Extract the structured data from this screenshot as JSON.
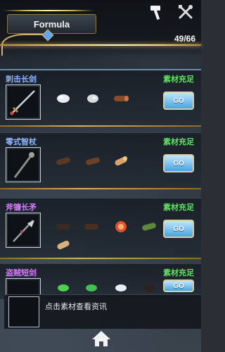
{
  "header": {
    "title": "Formula",
    "counter": "49/66",
    "icons": [
      "hammer-icon",
      "crossed-tools-icon"
    ]
  },
  "recipes": [
    {
      "name": "刺击长剑",
      "name_color": "#8fb6ff",
      "status": "素材充足",
      "go_label": "GO",
      "item_icon": "long-sword-icon",
      "materials": [
        "white-ore-icon",
        "white-ore-icon",
        "wood-log-icon"
      ]
    },
    {
      "name": "零式智杖",
      "name_color": "#8fb6ff",
      "status": "素材充足",
      "go_label": "GO",
      "item_icon": "wand-icon",
      "materials": [
        "dark-wood-icon",
        "dark-wood-icon",
        "wood-log-icon"
      ]
    },
    {
      "name": "斧镰长矛",
      "name_color": "#d77cff",
      "status": "素材充足",
      "go_label": "GO",
      "item_icon": "halberd-icon",
      "materials": [
        "dark-wood-icon",
        "dark-wood-icon",
        "red-orb-icon",
        "green-gem-icon",
        "wood-log-icon"
      ]
    },
    {
      "name": "盗贼短剑",
      "name_color": "#d77cff",
      "status": "素材充足",
      "go_label": "GO",
      "item_icon": "dagger-icon",
      "materials": [
        "green-gem-icon",
        "green-gem-icon",
        "white-ore-icon",
        "dark-wood-icon"
      ]
    }
  ],
  "tooltip": {
    "text": "点击素材查看资讯"
  },
  "colors": {
    "status_green": "#5ee65e",
    "gold": "#d9b560",
    "go_blue": "#4aa3df"
  }
}
